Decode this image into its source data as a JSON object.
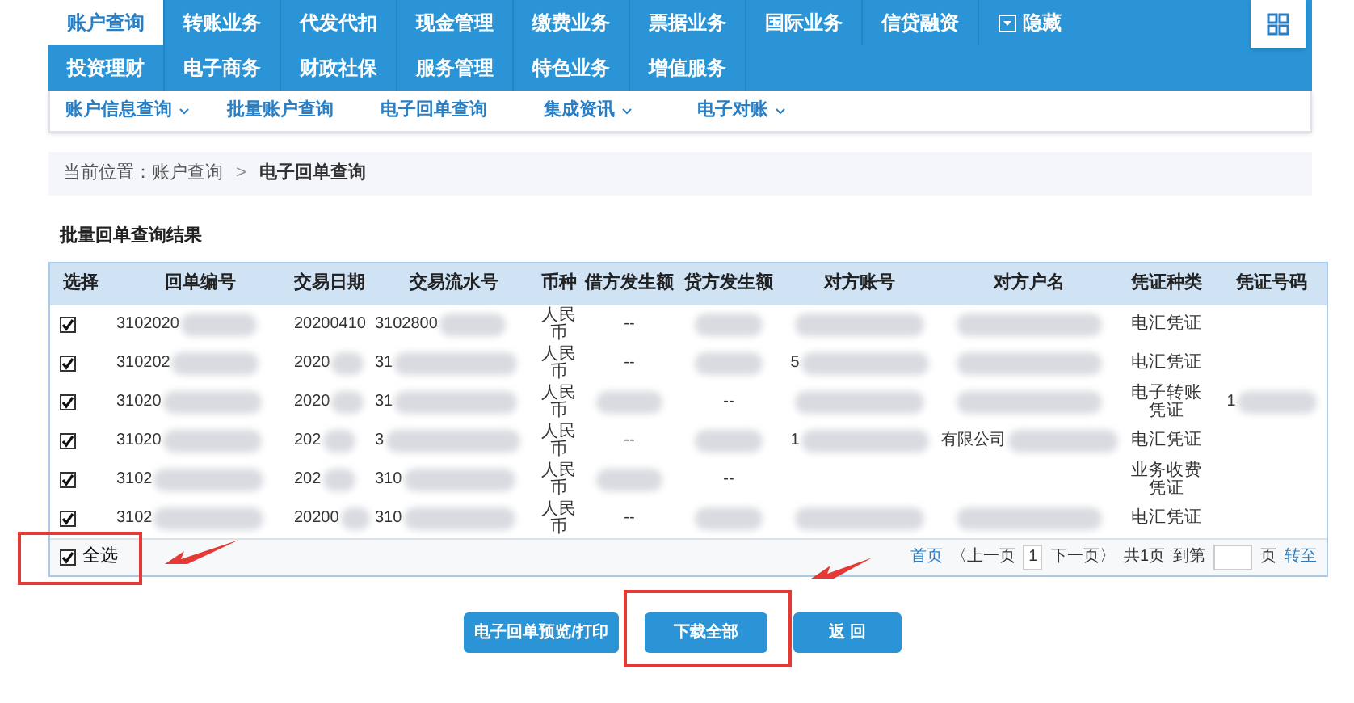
{
  "nav": {
    "rows": [
      [
        {
          "label": "账户查询",
          "selected": true
        },
        {
          "label": "转账业务",
          "selected": false
        },
        {
          "label": "代发代扣",
          "selected": false
        },
        {
          "label": "现金管理",
          "selected": false
        },
        {
          "label": "缴费业务",
          "selected": false
        },
        {
          "label": "票据业务",
          "selected": false
        },
        {
          "label": "国际业务",
          "selected": false
        },
        {
          "label": "信贷融资",
          "selected": false
        }
      ],
      [
        {
          "label": "投资理财",
          "selected": false
        },
        {
          "label": "电子商务",
          "selected": false
        },
        {
          "label": "财政社保",
          "selected": false
        },
        {
          "label": "服务管理",
          "selected": false
        },
        {
          "label": "特色业务",
          "selected": false
        },
        {
          "label": "增值服务",
          "selected": false
        }
      ]
    ],
    "hide_button": "隐藏"
  },
  "submenu": [
    {
      "label": "账户信息查询",
      "dropdown": true
    },
    {
      "label": "批量账户查询",
      "dropdown": false
    },
    {
      "label": "电子回单查询",
      "dropdown": false
    },
    {
      "label": "集成资讯",
      "dropdown": true
    },
    {
      "label": "电子对账",
      "dropdown": true
    }
  ],
  "breadcrumb": {
    "prefix": "当前位置：账户查询",
    "separator": ">",
    "current": "电子回单查询"
  },
  "section_title": "批量回单查询结果",
  "table": {
    "columns": [
      "选择",
      "回单编号",
      "交易日期",
      "交易流水号",
      "币种",
      "借方发生额",
      "贷方发生额",
      "对方账号",
      "对方户名",
      "凭证种类",
      "凭证号码"
    ],
    "rows": [
      {
        "cells": [
          {
            "kind": "checkbox",
            "checked": true
          },
          {
            "kind": "text",
            "text": "3102020",
            "blurred": true
          },
          {
            "kind": "text",
            "text": "20200410",
            "blurred": false
          },
          {
            "kind": "text",
            "text": "3102800",
            "blurred": true
          },
          {
            "kind": "text",
            "text": "人民币",
            "blurred": false
          },
          {
            "kind": "text",
            "text": "--",
            "blurred": false
          },
          {
            "kind": "text",
            "blurred": true
          },
          {
            "kind": "text",
            "blurred": true
          },
          {
            "kind": "text",
            "blurred": true
          },
          {
            "kind": "text",
            "text": "电汇凭证",
            "blurred": false
          },
          {
            "kind": "text",
            "blurred": false
          }
        ]
      },
      {
        "cells": [
          {
            "kind": "checkbox",
            "checked": true
          },
          {
            "kind": "text",
            "text": "310202",
            "blurred": true
          },
          {
            "kind": "text",
            "text": "2020",
            "blurred": true
          },
          {
            "kind": "text",
            "text": "31",
            "blurred": true
          },
          {
            "kind": "text",
            "text": "人民币",
            "blurred": false
          },
          {
            "kind": "text",
            "text": "--",
            "blurred": false
          },
          {
            "kind": "text",
            "blurred": true
          },
          {
            "kind": "text",
            "text": "5",
            "blurred": true
          },
          {
            "kind": "text",
            "blurred": true
          },
          {
            "kind": "text",
            "text": "电汇凭证",
            "blurred": false
          },
          {
            "kind": "text",
            "blurred": false
          }
        ]
      },
      {
        "cells": [
          {
            "kind": "checkbox",
            "checked": true
          },
          {
            "kind": "text",
            "text": "31020",
            "blurred": true
          },
          {
            "kind": "text",
            "text": "2020",
            "blurred": true
          },
          {
            "kind": "text",
            "text": "31",
            "blurred": true
          },
          {
            "kind": "text",
            "text": "人民币",
            "blurred": false
          },
          {
            "kind": "text",
            "blurred": true
          },
          {
            "kind": "text",
            "text": "--",
            "blurred": false
          },
          {
            "kind": "text",
            "blurred": true
          },
          {
            "kind": "text",
            "blurred": true
          },
          {
            "kind": "text",
            "text": "电子转账凭证",
            "blurred": false
          },
          {
            "kind": "text",
            "text": "1",
            "blurred": true
          }
        ]
      },
      {
        "cells": [
          {
            "kind": "checkbox",
            "checked": true
          },
          {
            "kind": "text",
            "text": "31020",
            "blurred": true
          },
          {
            "kind": "text",
            "text": "202",
            "blurred": true
          },
          {
            "kind": "text",
            "text": "3",
            "blurred": true
          },
          {
            "kind": "text",
            "text": "人民币",
            "blurred": false
          },
          {
            "kind": "text",
            "text": "--",
            "blurred": false
          },
          {
            "kind": "text",
            "blurred": true
          },
          {
            "kind": "text",
            "text": "1",
            "blurred": true
          },
          {
            "kind": "text",
            "text": "有限公司",
            "blurred": true
          },
          {
            "kind": "text",
            "text": "电汇凭证",
            "blurred": false
          },
          {
            "kind": "text",
            "blurred": false
          }
        ]
      },
      {
        "cells": [
          {
            "kind": "checkbox",
            "checked": true
          },
          {
            "kind": "text",
            "text": "3102",
            "blurred": true
          },
          {
            "kind": "text",
            "text": "202",
            "blurred": true
          },
          {
            "kind": "text",
            "text": "310",
            "blurred": true
          },
          {
            "kind": "text",
            "text": "人民币",
            "blurred": false
          },
          {
            "kind": "text",
            "blurred": true
          },
          {
            "kind": "text",
            "text": "--",
            "blurred": false
          },
          {
            "kind": "text",
            "blurred": false
          },
          {
            "kind": "text",
            "blurred": false
          },
          {
            "kind": "text",
            "text": "业务收费凭证",
            "blurred": false
          },
          {
            "kind": "text",
            "blurred": false
          }
        ]
      },
      {
        "cells": [
          {
            "kind": "checkbox",
            "checked": true
          },
          {
            "kind": "text",
            "text": "3102",
            "blurred": true
          },
          {
            "kind": "text",
            "text": "20200",
            "blurred": true
          },
          {
            "kind": "text",
            "text": "310",
            "blurred": true
          },
          {
            "kind": "text",
            "text": "人民币",
            "blurred": false
          },
          {
            "kind": "text",
            "text": "--",
            "blurred": false
          },
          {
            "kind": "text",
            "blurred": true
          },
          {
            "kind": "text",
            "blurred": true
          },
          {
            "kind": "text",
            "blurred": true
          },
          {
            "kind": "text",
            "text": "电汇凭证",
            "blurred": false
          },
          {
            "kind": "text",
            "blurred": false
          }
        ]
      }
    ]
  },
  "select_all": {
    "label": "全选",
    "checked": true
  },
  "pagination": [
    {
      "kind": "link",
      "text": "首页"
    },
    {
      "kind": "text",
      "text": "〈上一页"
    },
    {
      "kind": "input",
      "text": "1"
    },
    {
      "kind": "text",
      "text": "下一页〉"
    },
    {
      "kind": "text",
      "text": "共1页"
    },
    {
      "kind": "text",
      "text": "到第"
    },
    {
      "kind": "input"
    },
    {
      "kind": "text",
      "text": "页"
    },
    {
      "kind": "link",
      "text": "转至"
    }
  ],
  "buttons": [
    "电子回单预览/打印",
    "下载全部",
    "返 回"
  ]
}
